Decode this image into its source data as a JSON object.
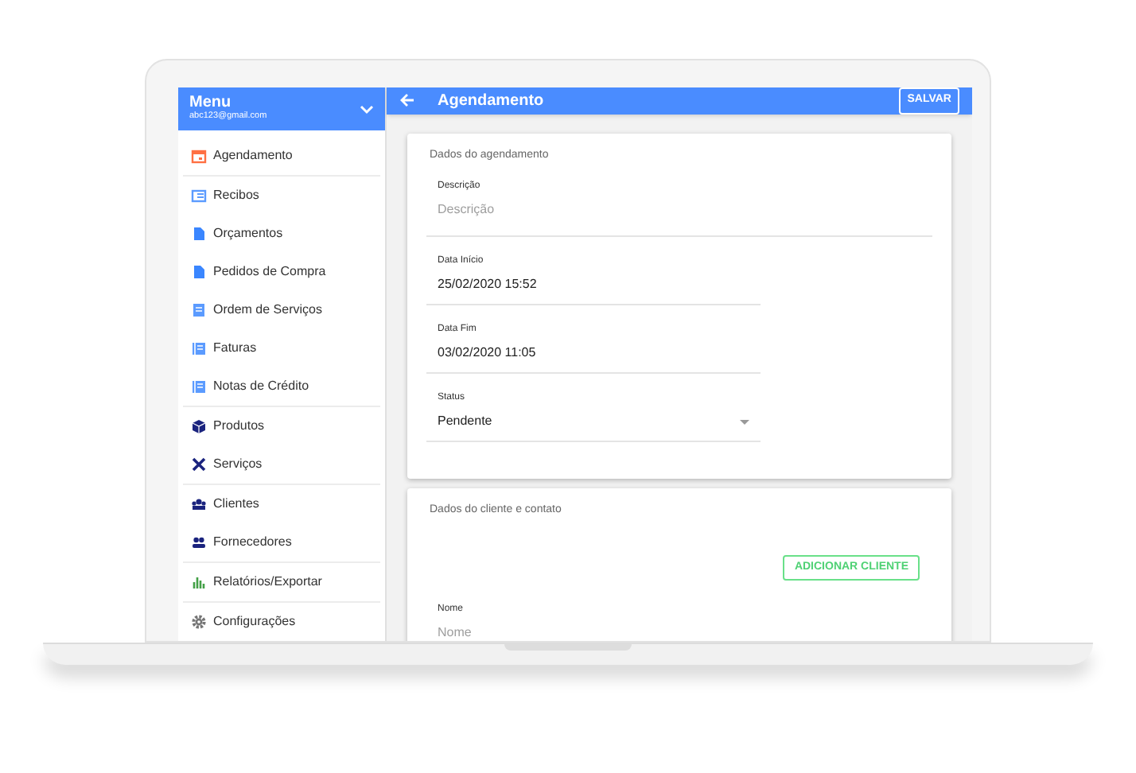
{
  "menu": {
    "title": "Menu",
    "email": "abc123@gmail.com"
  },
  "sidebar": {
    "sections": [
      [
        {
          "label": "Agendamento"
        }
      ],
      [
        {
          "label": "Recibos"
        },
        {
          "label": "Orçamentos"
        },
        {
          "label": "Pedidos de Compra"
        },
        {
          "label": "Ordem de Serviços"
        },
        {
          "label": "Faturas"
        },
        {
          "label": "Notas de Crédito"
        }
      ],
      [
        {
          "label": "Produtos"
        },
        {
          "label": "Serviços"
        }
      ],
      [
        {
          "label": "Clientes"
        },
        {
          "label": "Fornecedores"
        }
      ],
      [
        {
          "label": "Relatórios/Exportar"
        }
      ],
      [
        {
          "label": "Configurações"
        }
      ]
    ]
  },
  "header": {
    "title": "Agendamento",
    "save_button": "SALVAR"
  },
  "cards": [
    {
      "title": "Dados do agendamento",
      "fields": [
        {
          "kind": "text",
          "label": "Descrição",
          "placeholder": "Descrição",
          "wide": true
        },
        {
          "kind": "text",
          "label": "Data Início",
          "value": "25/02/2020 15:52",
          "wide": false
        },
        {
          "kind": "text",
          "label": "Data Fim",
          "value": "03/02/2020 11:05",
          "wide": false
        },
        {
          "kind": "select",
          "label": "Status",
          "value": "Pendente",
          "wide": false
        }
      ]
    },
    {
      "title": "Dados do cliente e contato",
      "button": "ADICIONAR CLIENTE",
      "fields": [
        {
          "kind": "text",
          "label": "Nome",
          "placeholder": "Nome",
          "wide": true
        }
      ]
    }
  ]
}
